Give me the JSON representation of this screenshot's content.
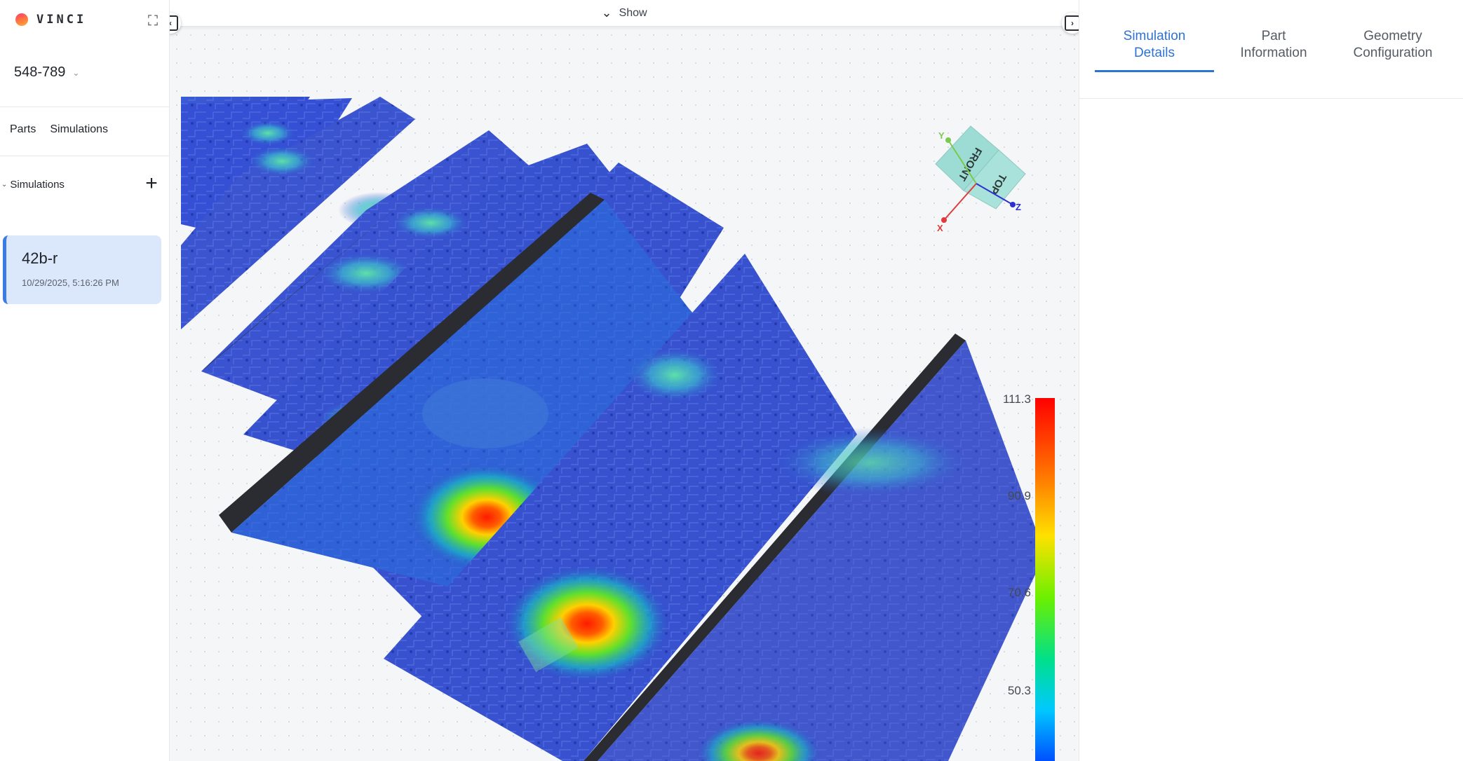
{
  "brand": {
    "name": "VINCI"
  },
  "project": {
    "name": "548-789"
  },
  "nav": {
    "parts": "Parts",
    "simulations": "Simulations"
  },
  "section": {
    "title": "Simulations"
  },
  "simulations": [
    {
      "name": "42b-r",
      "date": "10/29/2025, 5:16:26 PM"
    }
  ],
  "viewer": {
    "show_label": "Show",
    "cube": {
      "front": "FRONT",
      "top": "TOP",
      "x": "X",
      "y": "Y",
      "z": "Z"
    },
    "colorbar": {
      "labels": [
        "111.3",
        "90.9",
        "70.6",
        "50.3"
      ],
      "colors": [
        "#ff0000",
        "#ff7a00",
        "#ffe100",
        "#6cf000",
        "#00e08a",
        "#00c8ff",
        "#0050ff"
      ]
    }
  },
  "right_panel": {
    "tabs": [
      {
        "label": "Simulation\nDetails"
      },
      {
        "label": "Part\nInformation"
      },
      {
        "label": "Geometry\nConfiguration"
      }
    ]
  }
}
